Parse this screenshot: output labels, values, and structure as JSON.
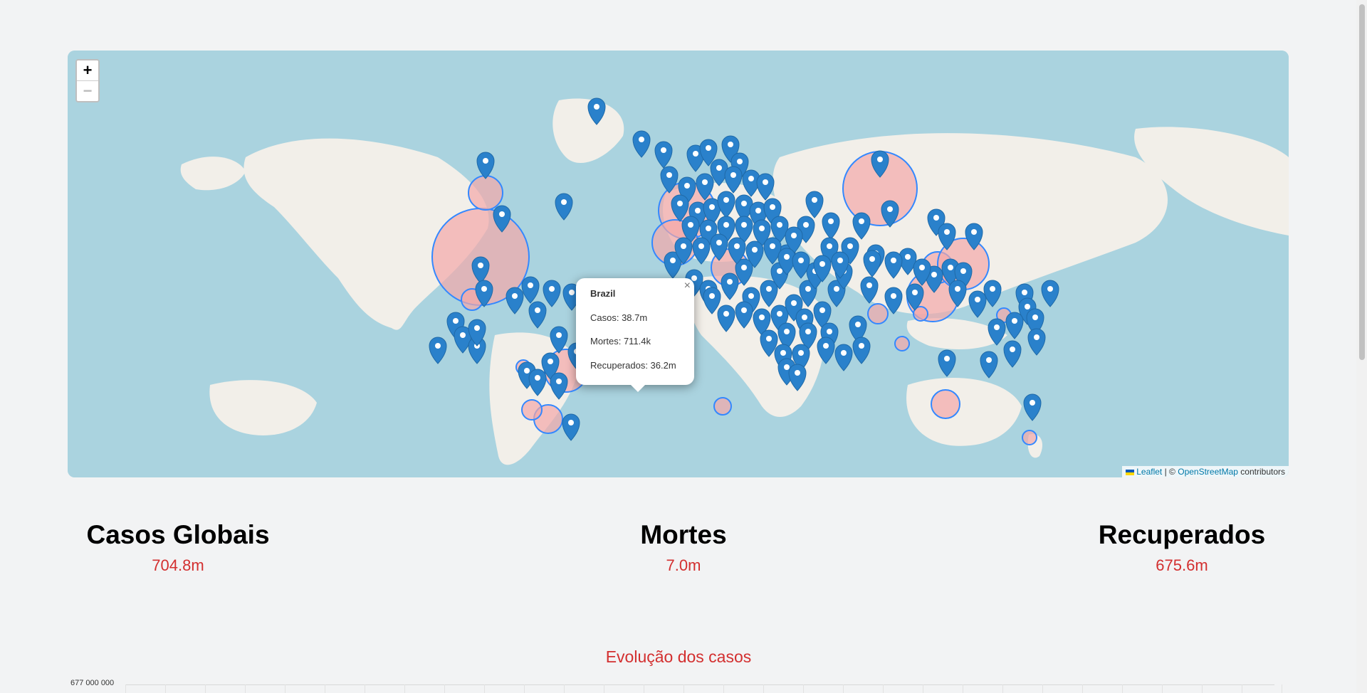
{
  "map": {
    "zoom_in_label": "+",
    "zoom_out_label": "−",
    "attribution": {
      "leaflet": "Leaflet",
      "separator": "| ©",
      "osm": "OpenStreetMap",
      "suffix": "contributors"
    },
    "popup": {
      "title": "Brazil",
      "close": "×",
      "cases": "Casos: 38.7m",
      "deaths": "Mortes: 711.4k",
      "recovered": "Recuperados: 36.2m"
    },
    "colors": {
      "water": "#aad3df",
      "land": "#f2efe9",
      "marker": "#2a81cb",
      "circle_fill": "#f4a8a8",
      "circle_stroke": "#3388ff"
    }
  },
  "stats": {
    "cases": {
      "label": "Casos Globais",
      "value": "704.8m"
    },
    "deaths": {
      "label": "Mortes",
      "value": "7.0m"
    },
    "recovered": {
      "label": "Recuperados",
      "value": "675.6m"
    }
  },
  "chart": {
    "title": "Evolução dos casos",
    "y_tick_top": "677 000 000"
  }
}
